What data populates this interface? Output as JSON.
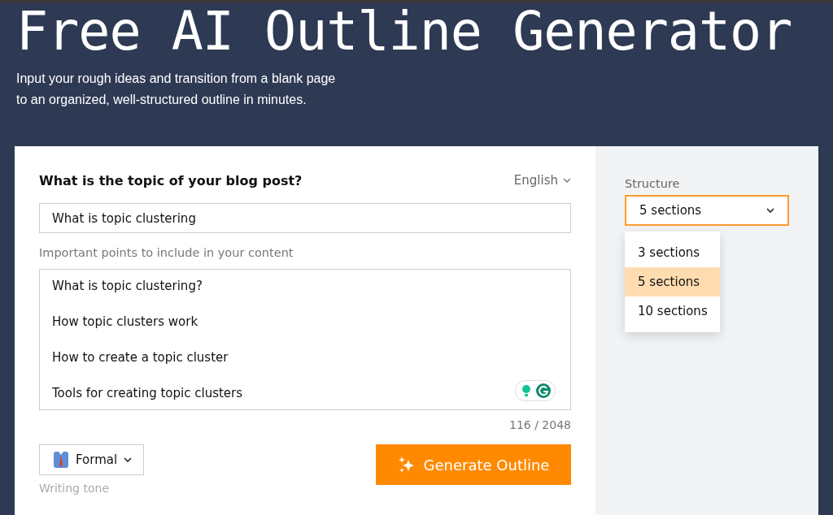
{
  "header": {
    "title": "Free AI Outline Generator",
    "subtitle": "Input your rough ideas and transition from a blank page\nto an organized, well-structured outline in minutes."
  },
  "form": {
    "topic_label": "What is the topic of your blog post?",
    "language": "English",
    "topic_value": "What is topic clustering",
    "points_label": "Important points to include in your content",
    "points": [
      "What is topic clustering?",
      "How topic clusters work",
      "How to create a topic cluster",
      "Tools for creating topic clusters"
    ],
    "counter": "116 / 2048",
    "tone": "Formal",
    "tone_label": "Writing tone",
    "generate_button": "Generate Outline"
  },
  "structure": {
    "label": "Structure",
    "value": "5 sections",
    "expanded": true,
    "options": [
      {
        "label": "3 sections",
        "selected": false
      },
      {
        "label": "5 sections",
        "selected": true
      },
      {
        "label": "10 sections",
        "selected": false
      }
    ]
  }
}
